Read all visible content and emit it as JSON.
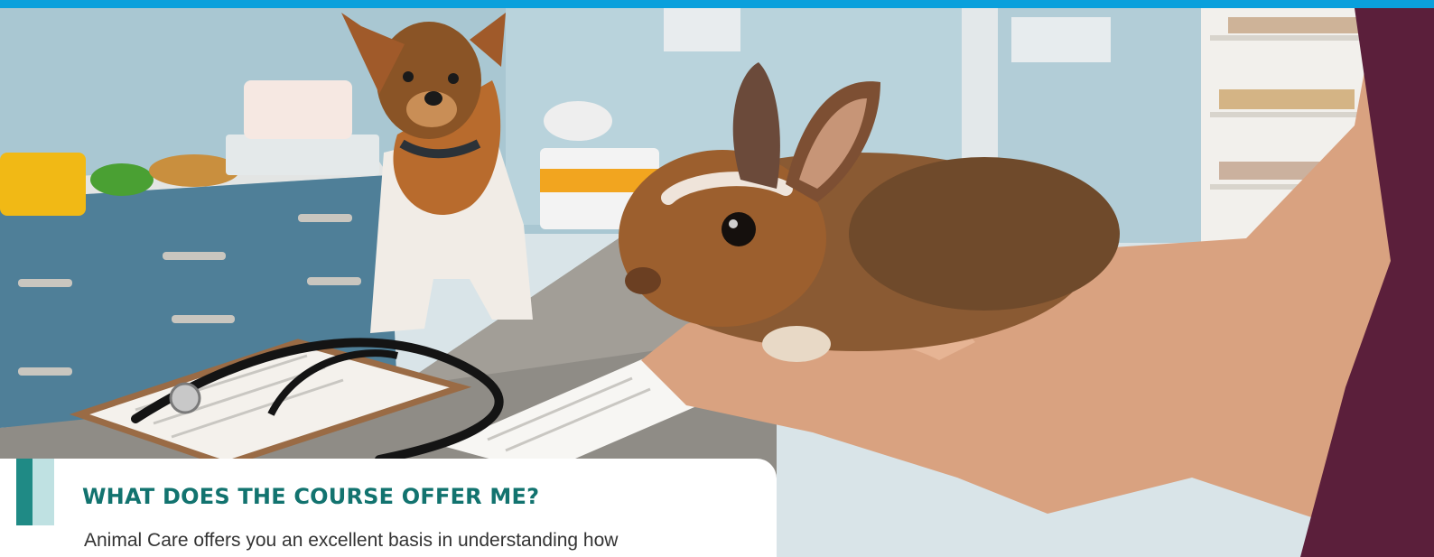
{
  "section": {
    "title": "WHAT DOES THE COURSE OFFER ME?",
    "body": "Animal Care offers you an excellent basis in understanding how"
  },
  "hero": {
    "subjects": [
      "veterinary-clinic",
      "dog",
      "rabbit",
      "hands",
      "stethoscope",
      "clipboard"
    ]
  },
  "colors": {
    "top_bar": "#0aa0dc",
    "heading": "#12736f",
    "accent_dark": "#1f8a85",
    "accent_light": "#bfe1e2",
    "body_text": "#333333"
  }
}
